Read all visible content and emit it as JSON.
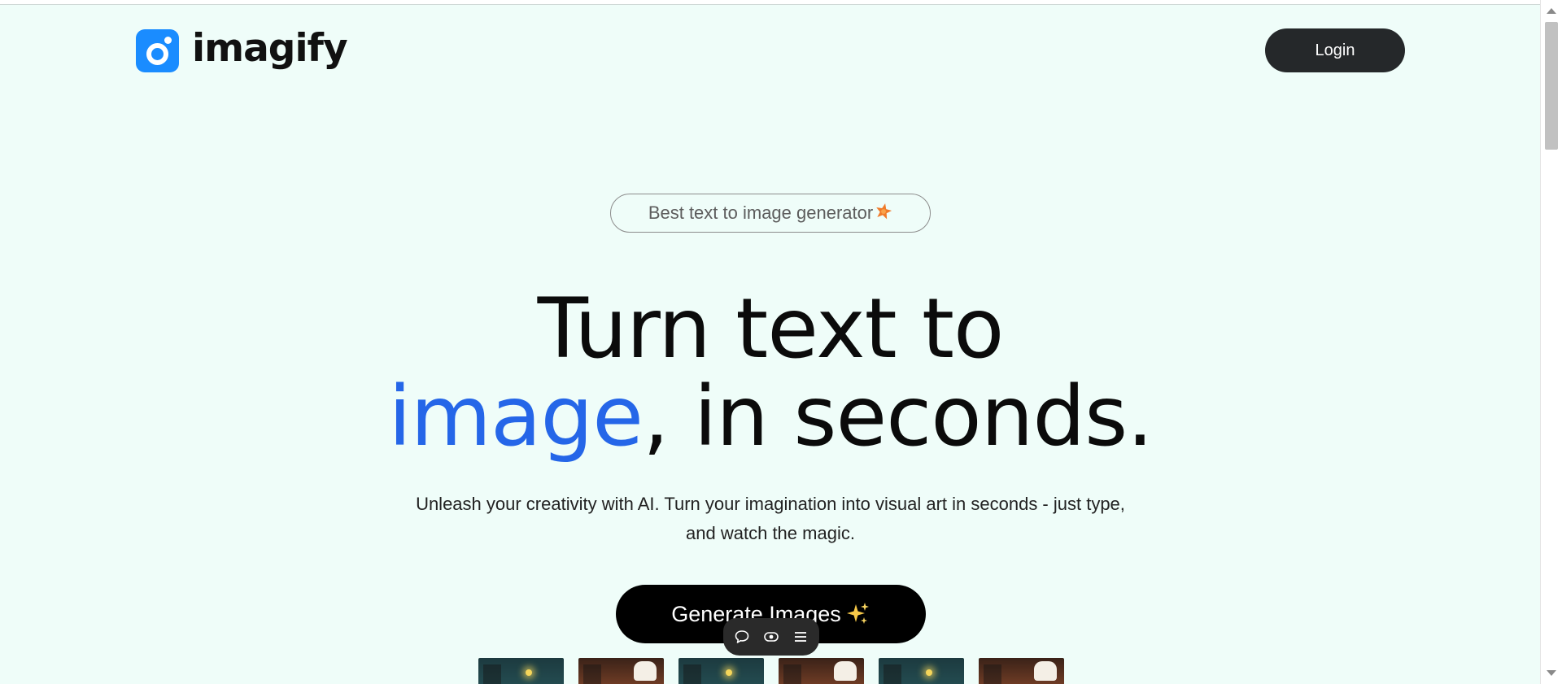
{
  "header": {
    "logo_text": "imagify",
    "login_label": "Login"
  },
  "hero": {
    "badge_text": "Best text to image generator",
    "badge_icon": "star-icon",
    "headline_line1": "Turn text to",
    "headline_accent": "image",
    "headline_rest": ", in seconds.",
    "subtext": "Unleash your creativity with AI. Turn your imagination into visual art in seconds - just type, and watch the magic.",
    "cta_label": "Generate Images",
    "cta_icon": "sparkles-icon"
  },
  "floating_toolbar": {
    "icons": [
      "comment-icon",
      "eye-icon",
      "menu-icon"
    ]
  },
  "gallery": {
    "thumbnail_count": 6
  },
  "colors": {
    "background": "#effdf9",
    "accent": "#2566e8",
    "logo_blue": "#1a8cff",
    "button_dark": "#25282a",
    "cta_black": "#000000"
  }
}
